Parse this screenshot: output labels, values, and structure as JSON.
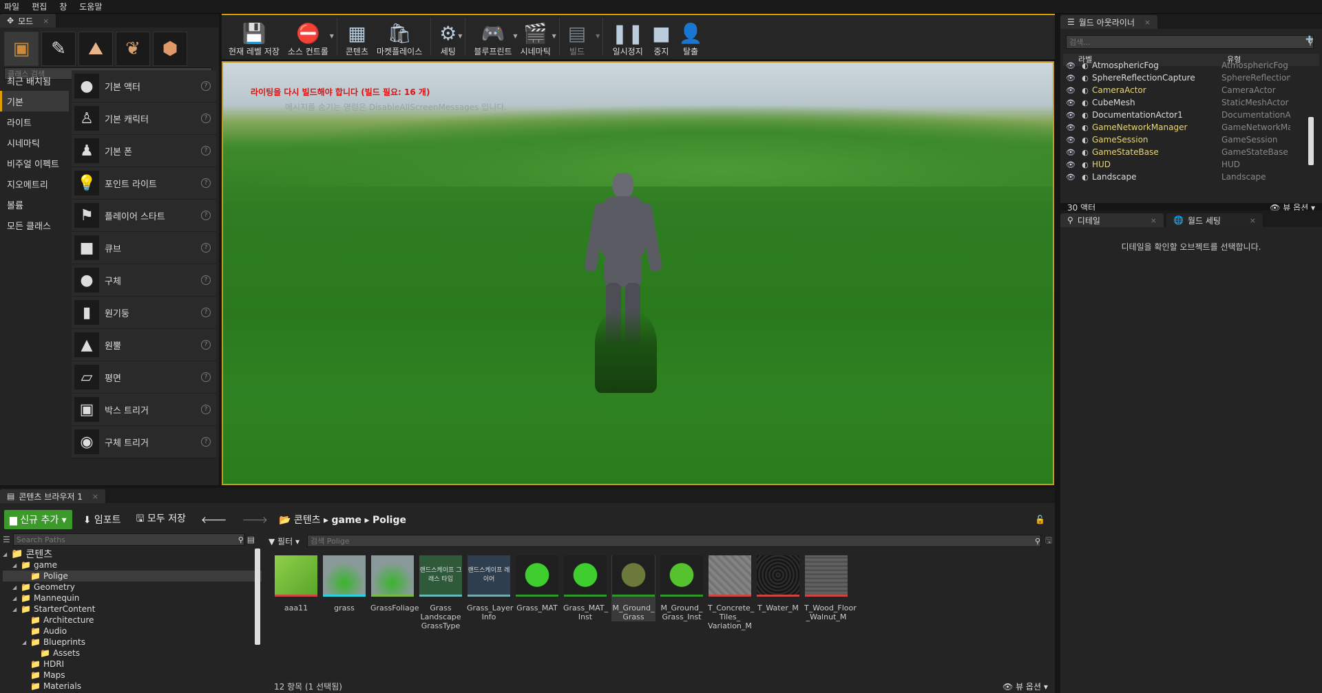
{
  "menu": [
    "파일",
    "편집",
    "창",
    "도움말"
  ],
  "modes": {
    "tab": "모드",
    "search_placeholder": "클래스 검색",
    "categories": [
      "최근 배치됨",
      "기본",
      "라이트",
      "시네마틱",
      "비주얼 이펙트",
      "지오메트리",
      "볼륨",
      "모든 클래스"
    ],
    "items": [
      "기본 액터",
      "기본 캐릭터",
      "기본 폰",
      "포인트 라이트",
      "플레이어 스타트",
      "큐브",
      "구체",
      "원기둥",
      "원뿔",
      "평면",
      "박스 트리거",
      "구체 트리거"
    ]
  },
  "toolbar": [
    "현재 레벨 저장",
    "소스 컨트롤",
    "콘텐츠",
    "마켓플레이스",
    "세팅",
    "블루프린트",
    "시네마틱",
    "빌드",
    "일시정지",
    "중지",
    "탈출"
  ],
  "viewport": {
    "warning": "라이팅을 다시 빌드해야 합니다 (빌드 필요: 16 개)",
    "hint": "메시지를 숨기는 명령은 DisableAllScreenMessages 입니다."
  },
  "outliner": {
    "tab": "월드 아웃라이너",
    "search_placeholder": "검색...",
    "col_label": "라벨",
    "col_type": "유형",
    "rows": [
      {
        "name": "AtmosphericFog",
        "type": "AtmosphericFog",
        "yellow": false
      },
      {
        "name": "SphereReflectionCapture",
        "type": "SphereReflectionC",
        "yellow": false
      },
      {
        "name": "CameraActor",
        "type": "CameraActor",
        "yellow": true
      },
      {
        "name": "CubeMesh",
        "type": "StaticMeshActor",
        "yellow": false
      },
      {
        "name": "DocumentationActor1",
        "type": "DocumentationAc",
        "yellow": false
      },
      {
        "name": "GameNetworkManager",
        "type": "GameNetworkMar",
        "yellow": true
      },
      {
        "name": "GameSession",
        "type": "GameSession",
        "yellow": true
      },
      {
        "name": "GameStateBase",
        "type": "GameStateBase",
        "yellow": true
      },
      {
        "name": "HUD",
        "type": "HUD",
        "yellow": true
      },
      {
        "name": "Landscape",
        "type": "Landscape",
        "yellow": false
      }
    ],
    "count": "30 액터",
    "view_options": "뷰 옵션"
  },
  "details": {
    "tab1": "디테일",
    "tab2": "월드 세팅",
    "message": "디테일을 확인할 오브젝트를 선택합니다."
  },
  "content_browser": {
    "tab": "콘텐츠 브라우저 1",
    "add_new": "신규 추가",
    "import": "임포트",
    "save_all": "모두 저장",
    "crumbs": [
      "콘텐츠",
      "game",
      "Polige"
    ],
    "path_search": "Search Paths",
    "filter": "필터",
    "asset_search": "검색 Polige",
    "tree": [
      {
        "label": "콘텐츠",
        "level": 0
      },
      {
        "label": "game",
        "level": 1
      },
      {
        "label": "Polige",
        "level": 2,
        "sel": true
      },
      {
        "label": "Geometry",
        "level": 1
      },
      {
        "label": "Mannequin",
        "level": 1
      },
      {
        "label": "StarterContent",
        "level": 1
      },
      {
        "label": "Architecture",
        "level": 2
      },
      {
        "label": "Audio",
        "level": 2
      },
      {
        "label": "Blueprints",
        "level": 2
      },
      {
        "label": "Assets",
        "level": 3
      },
      {
        "label": "HDRI",
        "level": 2
      },
      {
        "label": "Maps",
        "level": 2
      },
      {
        "label": "Materials",
        "level": 2
      }
    ],
    "assets": [
      {
        "name": "aaa11",
        "thumb_text": ""
      },
      {
        "name": "grass",
        "thumb_text": ""
      },
      {
        "name": "GrassFoliage",
        "thumb_text": ""
      },
      {
        "name": "Grass Landscape GrassType",
        "thumb_text": "랜드스케이프 그래스 타입"
      },
      {
        "name": "Grass_Layer Info",
        "thumb_text": "랜드스케이프 레이어"
      },
      {
        "name": "Grass_MAT",
        "thumb_text": ""
      },
      {
        "name": "Grass_MAT_ Inst",
        "thumb_text": ""
      },
      {
        "name": "M_Ground_ Grass",
        "thumb_text": ""
      },
      {
        "name": "M_Ground_ Grass_Inst",
        "thumb_text": ""
      },
      {
        "name": "T_Concrete_ Tiles_ Variation_M",
        "thumb_text": ""
      },
      {
        "name": "T_Water_M",
        "thumb_text": ""
      },
      {
        "name": "T_Wood_Floor _Walnut_M",
        "thumb_text": ""
      }
    ],
    "status": "12 항목 (1 선택됨)",
    "view_options": "뷰 옵션"
  }
}
